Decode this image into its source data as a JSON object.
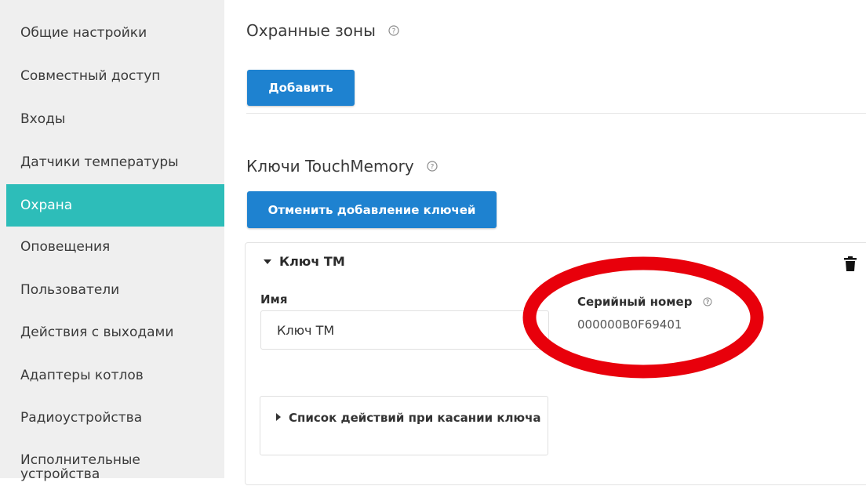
{
  "sidebar": {
    "items": [
      {
        "label": "Общие настройки"
      },
      {
        "label": "Совместный доступ"
      },
      {
        "label": "Входы"
      },
      {
        "label": "Датчики температуры"
      },
      {
        "label": "Охрана",
        "active": true
      },
      {
        "label": "Оповещения"
      },
      {
        "label": "Пользователи"
      },
      {
        "label": "Действия с выходами"
      },
      {
        "label": "Адаптеры котлов"
      },
      {
        "label": "Радиоустройства"
      },
      {
        "label": "Исполнительные устройства"
      }
    ]
  },
  "zones": {
    "title": "Охранные зоны",
    "add_button": "Добавить"
  },
  "keys": {
    "title": "Ключи TouchMemory",
    "cancel_button": "Отменить добавление ключей",
    "card": {
      "title": "Ключ ТМ",
      "name_label": "Имя",
      "name_value": "Ключ ТМ",
      "serial_label": "Серийный номер",
      "serial_value": "000000B0F69401",
      "actions_label": "Список действий при касании ключа"
    }
  },
  "colors": {
    "accent": "#2dbdb9",
    "button": "#1e82d0",
    "annotation": "#e8000b"
  },
  "icons": [
    "help-icon",
    "caret-down-icon",
    "caret-right-icon",
    "trash-icon"
  ]
}
